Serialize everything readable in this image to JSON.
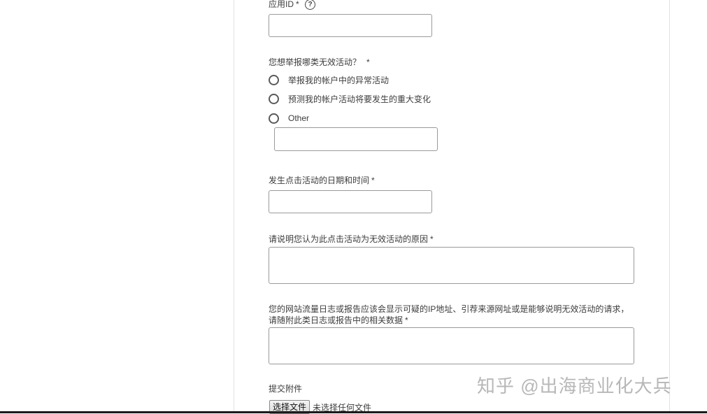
{
  "form": {
    "app_id": {
      "label": "应用ID",
      "required_mark": "*",
      "help_icon": "help-circle-icon",
      "help_glyph": "?"
    },
    "activity_type": {
      "label": "您想举报哪类无效活动？",
      "required_mark": "*",
      "options": [
        {
          "label": "举报我的帐户中的异常活动"
        },
        {
          "label": "预测我的帐户活动将要发生的重大变化"
        },
        {
          "label": "Other"
        }
      ]
    },
    "datetime": {
      "label": "发生点击活动的日期和时间",
      "required_mark": "*"
    },
    "reason": {
      "label": "请说明您认为此点击活动为无效活动的原因",
      "required_mark": "*"
    },
    "logs": {
      "label_line1": "您的网站流量日志或报告应该会显示可疑的IP地址、引荐来源网址或是能够说明无效活动的请求，",
      "label_line2": "请随附此类日志或报告中的相关数据",
      "required_mark": "*"
    },
    "attachment": {
      "label": "提交附件",
      "button_label": "选择文件",
      "status": "未选择任何文件"
    }
  },
  "watermark": {
    "text": "知乎 @出海商业化大兵"
  }
}
